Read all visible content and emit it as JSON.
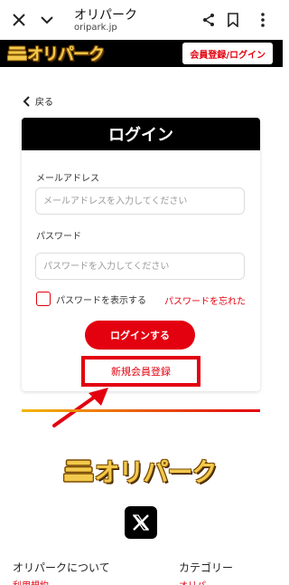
{
  "browser": {
    "title": "オリパーク",
    "url": "oripark.jp"
  },
  "header": {
    "logo": "オリパーク",
    "register_login": "会員登録/ログイン"
  },
  "back_label": "戻る",
  "login_card": {
    "title": "ログイン",
    "email_label": "メールアドレス",
    "email_placeholder": "メールアドレスを入力してください",
    "password_label": "パスワード",
    "password_placeholder": "パスワードを入力してください",
    "show_password": "パスワードを表示する",
    "forgot_password": "パスワードを忘れた",
    "login_button": "ログインする",
    "signup_link": "新規会員登録"
  },
  "footer": {
    "logo": "オリパーク",
    "about_heading": "オリパークについて",
    "about_sub": "利用規約",
    "category_heading": "カテゴリー",
    "category_sub": "オリパ"
  },
  "colors": {
    "accent": "#e3000f",
    "header_bg": "#000000",
    "logo_gold": "#f2c94c"
  }
}
